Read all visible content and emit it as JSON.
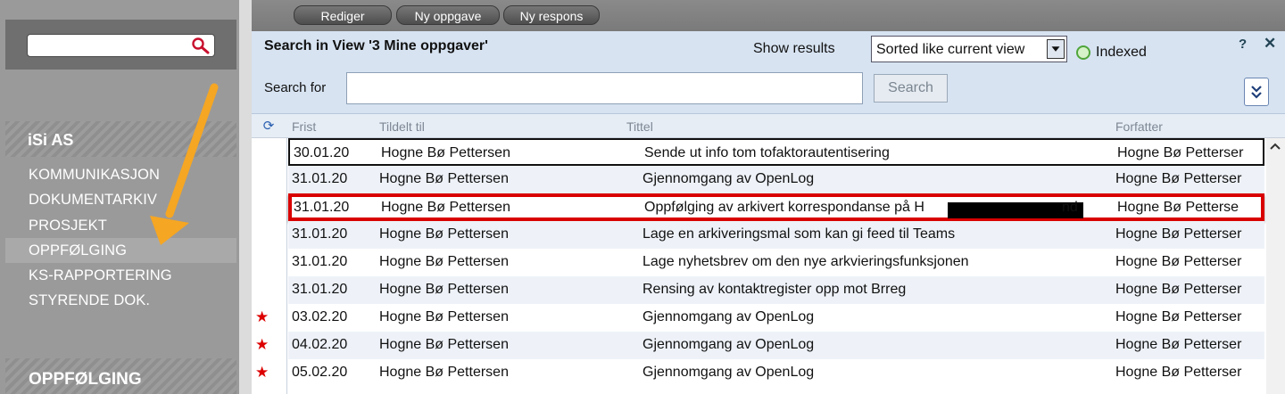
{
  "sidebar": {
    "company": "iSi AS",
    "items": [
      {
        "label": "KOMMUNIKASJON"
      },
      {
        "label": "DOKUMENTARKIV"
      },
      {
        "label": "PROSJEKT"
      },
      {
        "label": "OPPFØLGING"
      },
      {
        "label": "KS-RAPPORTERING"
      },
      {
        "label": "STYRENDE DOK."
      }
    ],
    "active_item": "OPPFØLGING",
    "bottom_title": "OPPFØLGING",
    "arrow_color": "#f5a623"
  },
  "toolbar": {
    "buttons": [
      {
        "label": "Rediger"
      },
      {
        "label": "Ny oppgave"
      },
      {
        "label": "Ny respons"
      }
    ]
  },
  "search": {
    "title": "Search in View '3 Mine oppgaver'",
    "show_results_label": "Show results",
    "sort_value": "Sorted like current view",
    "indexed_label": "Indexed",
    "help_label": "?",
    "close_label": "✕",
    "search_for_label": "Search for",
    "search_for_value": "",
    "search_button": "Search",
    "expand_icon": "chevron-double-down-icon"
  },
  "grid": {
    "columns": [
      "Frist",
      "Tildelt til",
      "Tittel",
      "Forfatter"
    ],
    "rows": [
      {
        "frist": "30.01.20",
        "tildelt": "Hogne Bø Pettersen",
        "tittel": "Sende ut info tom tofaktorautentisering",
        "forfatter": "Hogne Bø Petterser",
        "star": ""
      },
      {
        "frist": "31.01.20",
        "tildelt": "Hogne Bø Pettersen",
        "tittel": "Gjennomgang av OpenLog",
        "forfatter": "Hogne Bø Petterser",
        "star": ""
      },
      {
        "frist": "31.01.20",
        "tildelt": "Hogne Bø Pettersen",
        "tittel": "Oppfølging av arkivert korrespondanse på H",
        "tittel_end": "nd",
        "forfatter": "Hogne Bø Petterse",
        "star": ""
      },
      {
        "frist": "31.01.20",
        "tildelt": "Hogne Bø Pettersen",
        "tittel": "Lage en arkiveringsmal som kan gi feed til Teams",
        "forfatter": "Hogne Bø Petterser",
        "star": ""
      },
      {
        "frist": "31.01.20",
        "tildelt": "Hogne Bø Pettersen",
        "tittel": "Lage nyhetsbrev om den nye arkvieringsfunksjonen",
        "forfatter": "Hogne Bø Petterser",
        "star": ""
      },
      {
        "frist": "31.01.20",
        "tildelt": "Hogne Bø Pettersen",
        "tittel": "Rensing av kontaktregister opp mot Brreg",
        "forfatter": "Hogne Bø Petterser",
        "star": ""
      },
      {
        "frist": "03.02.20",
        "tildelt": "Hogne Bø Pettersen",
        "tittel": "Gjennomgang av OpenLog",
        "forfatter": "Hogne Bø Petterser",
        "star": "★"
      },
      {
        "frist": "04.02.20",
        "tildelt": "Hogne Bø Pettersen",
        "tittel": "Gjennomgang av OpenLog",
        "forfatter": "Hogne Bø Petterser",
        "star": "★"
      },
      {
        "frist": "05.02.20",
        "tildelt": "Hogne Bø Pettersen",
        "tittel": "Gjennomgang av OpenLog",
        "forfatter": "Hogne Bø Petterser",
        "star": "★"
      }
    ]
  }
}
